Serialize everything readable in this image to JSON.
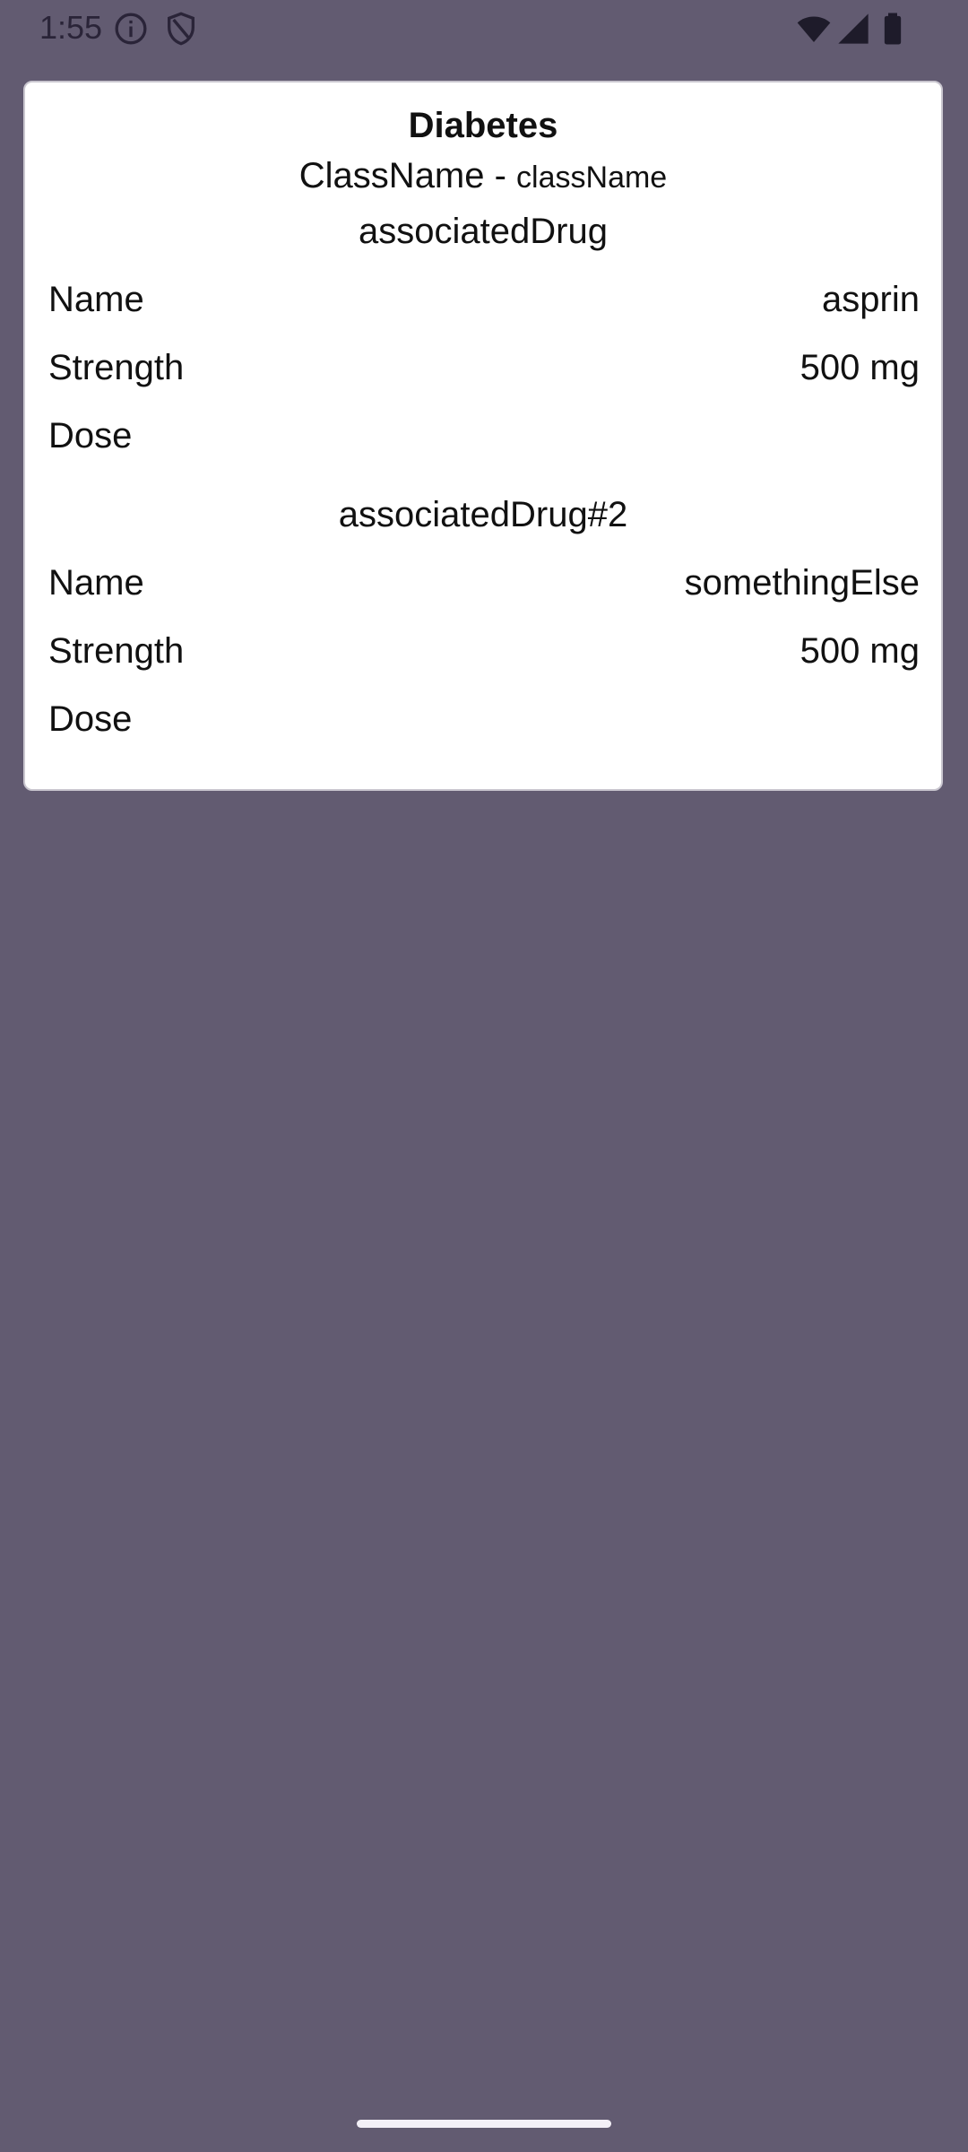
{
  "status_bar": {
    "time": "1:55",
    "icons": [
      "info-icon",
      "shield-icon",
      "wifi-icon",
      "signal-icon",
      "battery-icon"
    ]
  },
  "colors": {
    "background": "#625b71",
    "card": "#ffffff",
    "text": "#111111"
  },
  "card": {
    "title": "Diabetes",
    "class_label": "ClassName",
    "class_separator": " - ",
    "class_value": "className",
    "drugs": [
      {
        "section_title": "associatedDrug",
        "rows": [
          {
            "label": "Name",
            "value": "asprin"
          },
          {
            "label": "Strength",
            "value": "500 mg"
          },
          {
            "label": "Dose",
            "value": ""
          }
        ]
      },
      {
        "section_title": "associatedDrug#2",
        "rows": [
          {
            "label": "Name",
            "value": "somethingElse"
          },
          {
            "label": "Strength",
            "value": "500 mg"
          },
          {
            "label": "Dose",
            "value": ""
          }
        ]
      }
    ]
  }
}
